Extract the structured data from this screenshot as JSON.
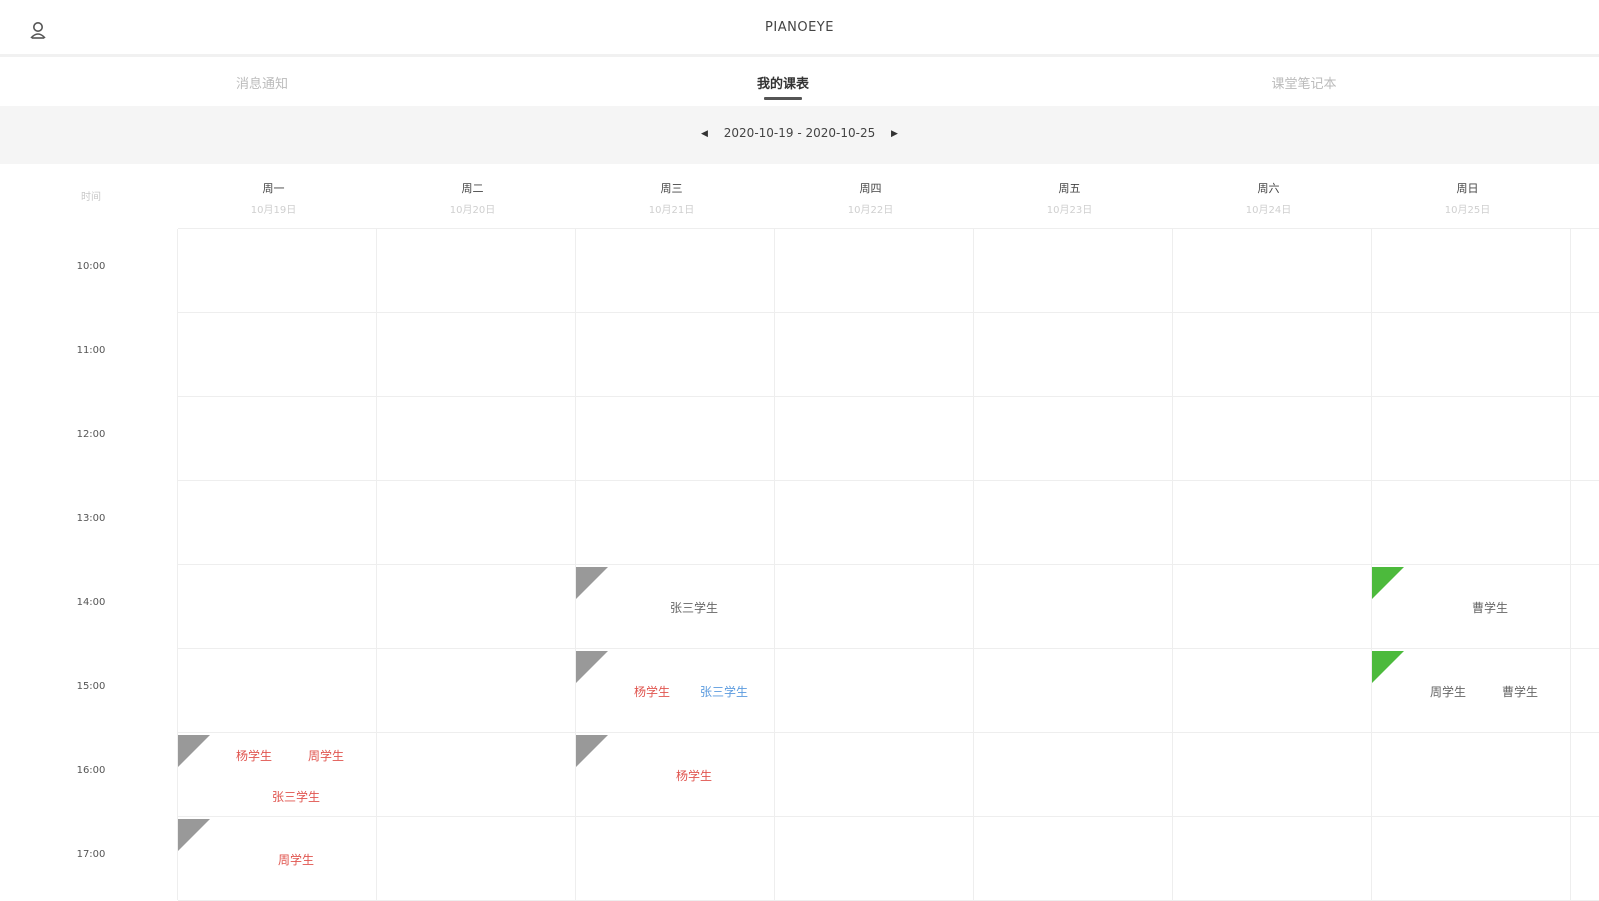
{
  "header": {
    "app_title": "PIANOEYE",
    "user_icon": "user-icon"
  },
  "tabs": [
    {
      "label": "消息通知"
    },
    {
      "label": "我的课表"
    },
    {
      "label": "课堂笔记本"
    }
  ],
  "week": {
    "range": "2020-10-19 - 2020-10-25",
    "prev_icon": "caret-left-icon",
    "next_icon": "caret-right-icon"
  },
  "schedule": {
    "time_header": "时间",
    "days": [
      {
        "name": "周一",
        "date": "10月19日"
      },
      {
        "name": "周二",
        "date": "10月20日"
      },
      {
        "name": "周三",
        "date": "10月21日"
      },
      {
        "name": "周四",
        "date": "10月22日"
      },
      {
        "name": "周五",
        "date": "10月23日"
      },
      {
        "name": "周六",
        "date": "10月24日"
      },
      {
        "name": "周日",
        "date": "10月25日"
      }
    ],
    "times": [
      "10:00",
      "11:00",
      "12:00",
      "13:00",
      "14:00",
      "15:00",
      "16:00",
      "17:00"
    ],
    "lessons": [
      {
        "day": 2,
        "time": "14:00",
        "status": "gray",
        "students": [
          {
            "name": "张三学生",
            "color": "gray"
          }
        ]
      },
      {
        "day": 6,
        "time": "14:00",
        "status": "green",
        "students": [
          {
            "name": "曹学生",
            "color": "gray"
          }
        ]
      },
      {
        "day": 2,
        "time": "15:00",
        "status": "gray",
        "students": [
          {
            "name": "杨学生",
            "color": "red"
          },
          {
            "name": "张三学生",
            "color": "blue"
          }
        ]
      },
      {
        "day": 6,
        "time": "15:00",
        "status": "green",
        "students": [
          {
            "name": "周学生",
            "color": "gray"
          },
          {
            "name": "曹学生",
            "color": "gray"
          }
        ]
      },
      {
        "day": 0,
        "time": "16:00",
        "status": "gray",
        "students": [
          {
            "name": "杨学生",
            "color": "red"
          },
          {
            "name": "周学生",
            "color": "red"
          },
          {
            "name": "张三学生",
            "color": "red"
          }
        ]
      },
      {
        "day": 2,
        "time": "16:00",
        "status": "gray",
        "students": [
          {
            "name": "杨学生",
            "color": "red"
          }
        ]
      },
      {
        "day": 0,
        "time": "17:00",
        "status": "gray",
        "students": [
          {
            "name": "周学生",
            "color": "red"
          }
        ]
      }
    ],
    "status_colors": {
      "gray": "#999999",
      "green": "#4cba3c"
    },
    "text_colors": {
      "red": "#e0554f",
      "gray": "#666666",
      "blue": "#5b9bdf"
    }
  }
}
